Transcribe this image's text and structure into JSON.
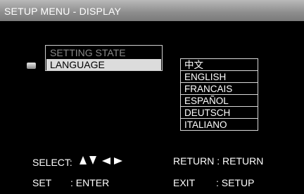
{
  "header": {
    "title": "SETUP MENU - DISPLAY"
  },
  "menu": {
    "items": [
      {
        "label": "SETTING STATE",
        "state": "disabled"
      },
      {
        "label": "LANGUAGE",
        "state": "selected"
      }
    ]
  },
  "languages": [
    "中文",
    "ENGLISH",
    "FRANCAIS",
    "ESPAÑOL",
    "DEUTSCH",
    "ITALIANO"
  ],
  "footer": {
    "select_label": "SELECT:",
    "select_icons": [
      "arrow-up-icon",
      "arrow-down-icon",
      "arrow-left-icon",
      "arrow-right-icon"
    ],
    "return_label": "RETURN : RETURN",
    "set_key": "SET",
    "set_action": ": ENTER",
    "exit_key": "EXIT",
    "exit_action": ": SETUP"
  },
  "colors": {
    "background": "#000000",
    "titlebar": "#9a9a9a",
    "highlight": "#dcdcdc",
    "dim_text": "#8a8a8a"
  }
}
